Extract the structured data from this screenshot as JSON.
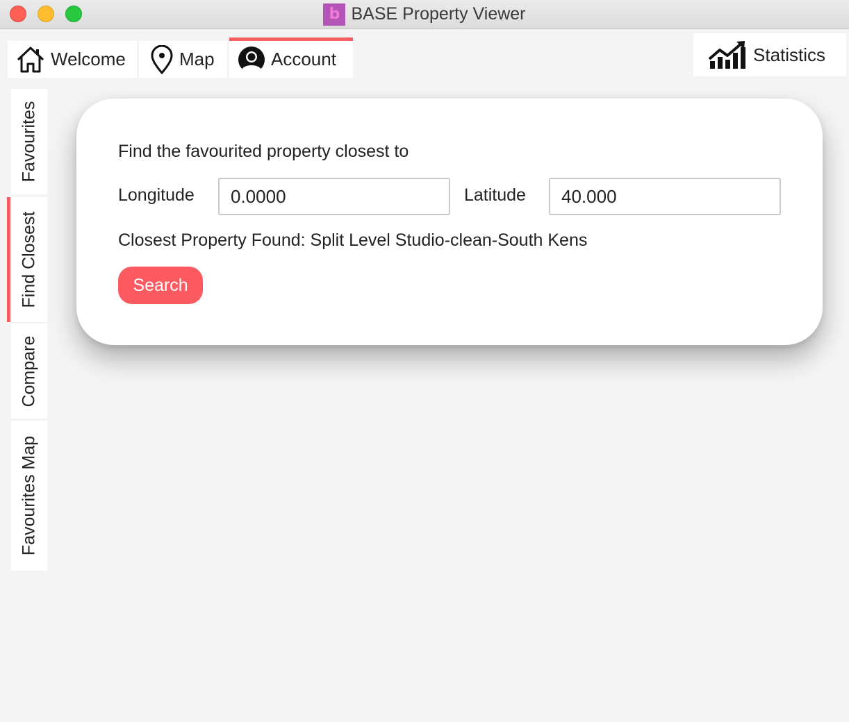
{
  "window": {
    "title": "BASE Property Viewer",
    "app_icon_letter": "b"
  },
  "top_tabs": [
    {
      "label": "Welcome",
      "icon": "home-icon",
      "selected": false
    },
    {
      "label": "Map",
      "icon": "map-pin-icon",
      "selected": false
    },
    {
      "label": "Account",
      "icon": "user-icon",
      "selected": true
    }
  ],
  "statistics_button": {
    "label": "Statistics",
    "icon": "chart-trend-icon"
  },
  "side_tabs": [
    {
      "label": "Favourites",
      "selected": false
    },
    {
      "label": "Find Closest",
      "selected": true
    },
    {
      "label": "Compare",
      "selected": false
    },
    {
      "label": "Favourites Map",
      "selected": false
    }
  ],
  "find_closest": {
    "prompt": "Find the favourited property closest to",
    "longitude_label": "Longitude",
    "longitude_value": "0.0000",
    "latitude_label": "Latitude",
    "latitude_value": "40.000",
    "result_text": "Closest Property Found: Split Level Studio-clean-South Kens",
    "search_label": "Search"
  },
  "colors": {
    "accent": "#f75c63",
    "app_icon_bg": "#b554b8",
    "background": "#f4f4f4"
  }
}
